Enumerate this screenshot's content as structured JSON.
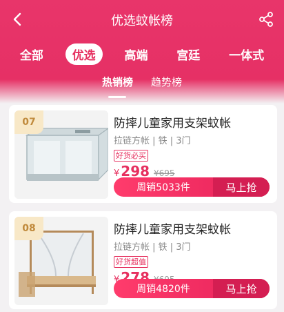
{
  "header": {
    "title": "优选蚊帐榜",
    "back_icon": "chevron-left-icon",
    "share_icon": "share-icon"
  },
  "categories": [
    {
      "label": "全部",
      "active": false
    },
    {
      "label": "优选",
      "active": true
    },
    {
      "label": "高端",
      "active": false
    },
    {
      "label": "宫廷",
      "active": false
    },
    {
      "label": "一体式",
      "active": false
    }
  ],
  "subtabs": [
    {
      "label": "热销榜",
      "active": true
    },
    {
      "label": "趋势榜",
      "active": false
    }
  ],
  "products": [
    {
      "rank": "07",
      "name": "防摔儿童家用支架蚊帐",
      "spec": "拉链方帐 | 铁 | 3门",
      "badge": "好货必买",
      "currency": "¥",
      "price": "298",
      "original_price": "¥695",
      "sales": "周销5033件",
      "buy_label": "马上抢"
    },
    {
      "rank": "08",
      "name": "防摔儿童家用支架蚊帐",
      "spec": "拉链方帐 | 铁 | 3门",
      "badge": "好货超值",
      "currency": "¥",
      "price": "278",
      "original_price": "¥695",
      "sales": "周销4820件",
      "buy_label": "马上抢"
    }
  ],
  "colors": {
    "accent": "#e6305f",
    "rank_bg": "#f8e8c7",
    "rank_text": "#c08a3c"
  }
}
